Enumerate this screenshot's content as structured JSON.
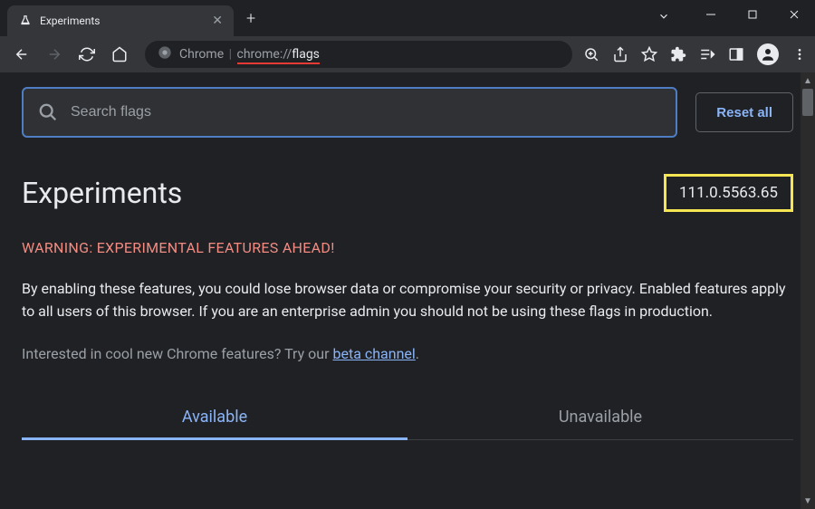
{
  "window": {
    "tab_title": "Experiments"
  },
  "addressbar": {
    "prefix": "Chrome",
    "url_scheme": "chrome://",
    "url_path": "flags"
  },
  "search": {
    "placeholder": "Search flags"
  },
  "buttons": {
    "reset": "Reset all"
  },
  "page": {
    "title": "Experiments",
    "version": "111.0.5563.65",
    "warning": "WARNING: EXPERIMENTAL FEATURES AHEAD!",
    "description": "By enabling these features, you could lose browser data or compromise your security or privacy. Enabled features apply to all users of this browser. If you are an enterprise admin you should not be using these flags in production.",
    "interested_prefix": "Interested in cool new Chrome features? Try our ",
    "beta_link": "beta channel",
    "interested_suffix": "."
  },
  "tabs": {
    "available": "Available",
    "unavailable": "Unavailable"
  }
}
